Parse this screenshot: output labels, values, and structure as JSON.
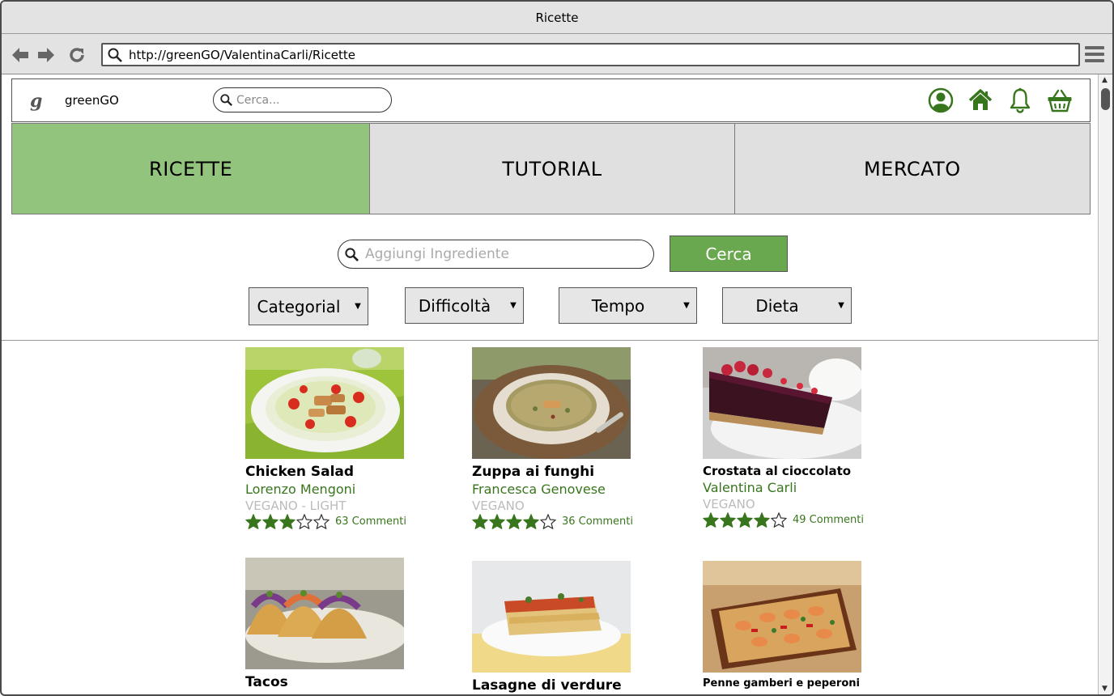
{
  "browser": {
    "window_title": "Ricette",
    "url": "http://greenGO/ValentinaCarli/Ricette"
  },
  "header": {
    "logo_letter": "g",
    "brand": "greenGO",
    "search_placeholder": "Cerca..."
  },
  "tabs": [
    {
      "label": "RICETTE",
      "active": true
    },
    {
      "label": "TUTORIAL",
      "active": false
    },
    {
      "label": "MERCATO",
      "active": false
    }
  ],
  "search": {
    "placeholder": "Aggiungi Ingrediente",
    "button_label": "Cerca"
  },
  "filters": [
    {
      "label": "Categorial"
    },
    {
      "label": "Difficoltà"
    },
    {
      "label": "Tempo"
    },
    {
      "label": "Dieta"
    }
  ],
  "recipes": [
    {
      "title": "Chicken Salad",
      "author": "Lorenzo Mengoni",
      "tags": "VEGANO - LIGHT",
      "rating": 3,
      "max_rating": 5,
      "comments": "63 Commenti"
    },
    {
      "title": "Zuppa ai funghi",
      "author": "Francesca Genovese",
      "tags": "VEGANO",
      "rating": 4,
      "max_rating": 5,
      "comments": "36 Commenti"
    },
    {
      "title": "Crostata al cioccolato",
      "author": "Valentina Carli",
      "tags": "VEGANO",
      "rating": 4,
      "max_rating": 5,
      "comments": "49 Commenti"
    },
    {
      "title": "Tacos"
    },
    {
      "title": "Lasagne di verdure"
    },
    {
      "title": "Penne gamberi e peperoni"
    }
  ],
  "colors": {
    "accent_green": "#6aa84f",
    "active_tab": "#93c47d",
    "icon_green": "#38761d"
  }
}
